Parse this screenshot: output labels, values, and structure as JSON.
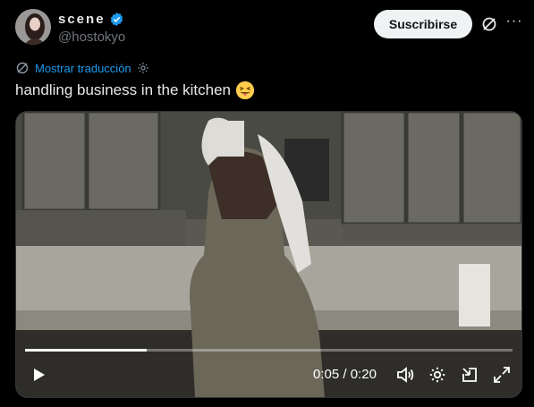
{
  "header": {
    "display_name": "scene",
    "handle": "@hostokyo",
    "subscribe_label": "Suscribirse",
    "more_icon": "ellipsis-icon",
    "grok_icon": "grok-icon",
    "verified_icon": "verified-badge-icon"
  },
  "translate": {
    "label": "Mostrar traducción",
    "icon": "translate-icon",
    "settings_icon": "gear-icon"
  },
  "tweet": {
    "text": "handling business in the kitchen",
    "emoji": "😝"
  },
  "video": {
    "current_time": "0:05",
    "separator": " / ",
    "duration": "0:20",
    "progress_fraction": 0.25,
    "controls": [
      "play-icon",
      "volume-icon",
      "settings-icon",
      "popout-icon",
      "fullscreen-icon"
    ]
  },
  "colors": {
    "accent": "#1d9bf0",
    "text": "#e7e9ea",
    "muted": "#71767b",
    "background": "#000000"
  }
}
